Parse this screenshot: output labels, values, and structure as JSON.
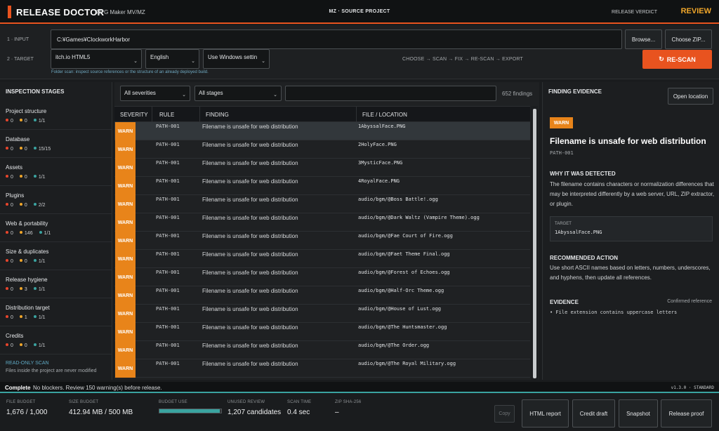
{
  "header": {
    "brand": "RELEASE DOCTOR",
    "subtitle": "RPG Maker MV/MZ",
    "project": "MZ · SOURCE PROJECT",
    "verdict_label": "RELEASE VERDICT",
    "verdict": "REVIEW",
    "accent": "#e8531f",
    "verdict_color": "#f0a62a"
  },
  "inputs": {
    "input_label": "1 · INPUT",
    "target_label": "2 · TARGET",
    "path": "C:¥Games¥ClockworkHarbor",
    "browse": "Browse...",
    "choose_zip": "Choose ZIP...",
    "platform": "itch.io HTML5",
    "language": "English",
    "line_endings": "Use Windows settin",
    "hint": "Folder scan: inspect source references or the structure of an already deployed build.",
    "flow": "CHOOSE → SCAN → FIX → RE-SCAN → EXPORT",
    "rescan": "RE-SCAN",
    "rescan_icon": "↻"
  },
  "stages": {
    "title": "INSPECTION STAGES",
    "items": [
      {
        "name": "Project structure",
        "red": "0",
        "amber": "0",
        "teal": "1/1"
      },
      {
        "name": "Database",
        "red": "0",
        "amber": "0",
        "teal": "15/15"
      },
      {
        "name": "Assets",
        "red": "0",
        "amber": "0",
        "teal": "1/1"
      },
      {
        "name": "Plugins",
        "red": "0",
        "amber": "0",
        "teal": "2/2"
      },
      {
        "name": "Web & portability",
        "red": "0",
        "amber": "146",
        "teal": "1/1"
      },
      {
        "name": "Size & duplicates",
        "red": "0",
        "amber": "0",
        "teal": "1/1"
      },
      {
        "name": "Release hygiene",
        "red": "0",
        "amber": "3",
        "teal": "1/1"
      },
      {
        "name": "Distribution target",
        "red": "0",
        "amber": "1",
        "teal": "1/1"
      },
      {
        "name": "Credits",
        "red": "0",
        "amber": "0",
        "teal": "1/1"
      }
    ],
    "readonly_title": "READ-ONLY SCAN",
    "readonly_sub": "Files inside the project are never modified",
    "colors": {
      "red": "#e8452c",
      "amber": "#f0a62a",
      "teal": "#3aa3a0"
    }
  },
  "findings": {
    "severity_filter": "All severities",
    "stage_filter": "All stages",
    "search_value": "",
    "count": "652 findings",
    "columns": [
      "SEVERITY",
      "RULE",
      "FINDING",
      "FILE / LOCATION"
    ],
    "rows": [
      {
        "severity": "WARN",
        "rule": "PATH-001",
        "finding": "Filename is unsafe for web distribution",
        "location": "1AbyssalFace.PNG"
      },
      {
        "severity": "WARN",
        "rule": "PATH-001",
        "finding": "Filename is unsafe for web distribution",
        "location": "2HolyFace.PNG"
      },
      {
        "severity": "WARN",
        "rule": "PATH-001",
        "finding": "Filename is unsafe for web distribution",
        "location": "3MysticFace.PNG"
      },
      {
        "severity": "WARN",
        "rule": "PATH-001",
        "finding": "Filename is unsafe for web distribution",
        "location": "4RoyalFace.PNG"
      },
      {
        "severity": "WARN",
        "rule": "PATH-001",
        "finding": "Filename is unsafe for web distribution",
        "location": "audio/bgm/@Boss Battle!.ogg"
      },
      {
        "severity": "WARN",
        "rule": "PATH-001",
        "finding": "Filename is unsafe for web distribution",
        "location": "audio/bgm/@Dark Waltz (Vampire Theme).ogg"
      },
      {
        "severity": "WARN",
        "rule": "PATH-001",
        "finding": "Filename is unsafe for web distribution",
        "location": "audio/bgm/@Fae Court of Fire.ogg"
      },
      {
        "severity": "WARN",
        "rule": "PATH-001",
        "finding": "Filename is unsafe for web distribution",
        "location": "audio/bgm/@Faet Theme Final.ogg"
      },
      {
        "severity": "WARN",
        "rule": "PATH-001",
        "finding": "Filename is unsafe for web distribution",
        "location": "audio/bgm/@Forest of Echoes.ogg"
      },
      {
        "severity": "WARN",
        "rule": "PATH-001",
        "finding": "Filename is unsafe for web distribution",
        "location": "audio/bgm/@Half-Orc Theme.ogg"
      },
      {
        "severity": "WARN",
        "rule": "PATH-001",
        "finding": "Filename is unsafe for web distribution",
        "location": "audio/bgm/@House of Lust.ogg"
      },
      {
        "severity": "WARN",
        "rule": "PATH-001",
        "finding": "Filename is unsafe for web distribution",
        "location": "audio/bgm/@The Huntsmaster.ogg"
      },
      {
        "severity": "WARN",
        "rule": "PATH-001",
        "finding": "Filename is unsafe for web distribution",
        "location": "audio/bgm/@The Order.ogg"
      },
      {
        "severity": "WARN",
        "rule": "PATH-001",
        "finding": "Filename is unsafe for web distribution",
        "location": "audio/bgm/@The Royal Military.ogg"
      }
    ],
    "warn_color": "#e8841a"
  },
  "evidence": {
    "title": "FINDING EVIDENCE",
    "open_location": "Open location",
    "badge": "WARN",
    "headline": "Filename is unsafe for web distribution",
    "rule": "PATH-001",
    "why_title": "WHY IT WAS DETECTED",
    "why_text": "The filename contains characters or normalization differences that may be interpreted differently by a web server, URL, ZIP extractor, or plugin.",
    "target_label": "TARGET",
    "target_value": "1AbyssalFace.PNG",
    "action_title": "RECOMMENDED ACTION",
    "action_text": "Use short ASCII names based on letters, numbers, underscores, and hyphens, then update all references.",
    "evidence_title": "EVIDENCE",
    "confirmed": "Confirmed reference",
    "bullet": "• File extension contains uppercase letters"
  },
  "status": {
    "label": "Complete",
    "message": "No blockers. Review 150 warning(s) before release.",
    "version": "v1.3.0 · STANDARD"
  },
  "footer": {
    "file_budget_label": "FILE BUDGET",
    "file_budget": "1,676 / 1,000",
    "size_budget_label": "SIZE BUDGET",
    "size_budget": "412.94 MB / 500 MB",
    "budget_use_label": "BUDGET USE",
    "budget_use_fraction": 0.98,
    "unused_label": "UNUSED REVIEW",
    "unused": "1,207 candidates",
    "scan_time_label": "SCAN TIME",
    "scan_time": "0.4 sec",
    "zip_label": "ZIP SHA-256",
    "zip_value": "–",
    "copy": "Copy",
    "buttons": [
      "HTML report",
      "Credit draft",
      "Snapshot",
      "Release proof"
    ]
  }
}
